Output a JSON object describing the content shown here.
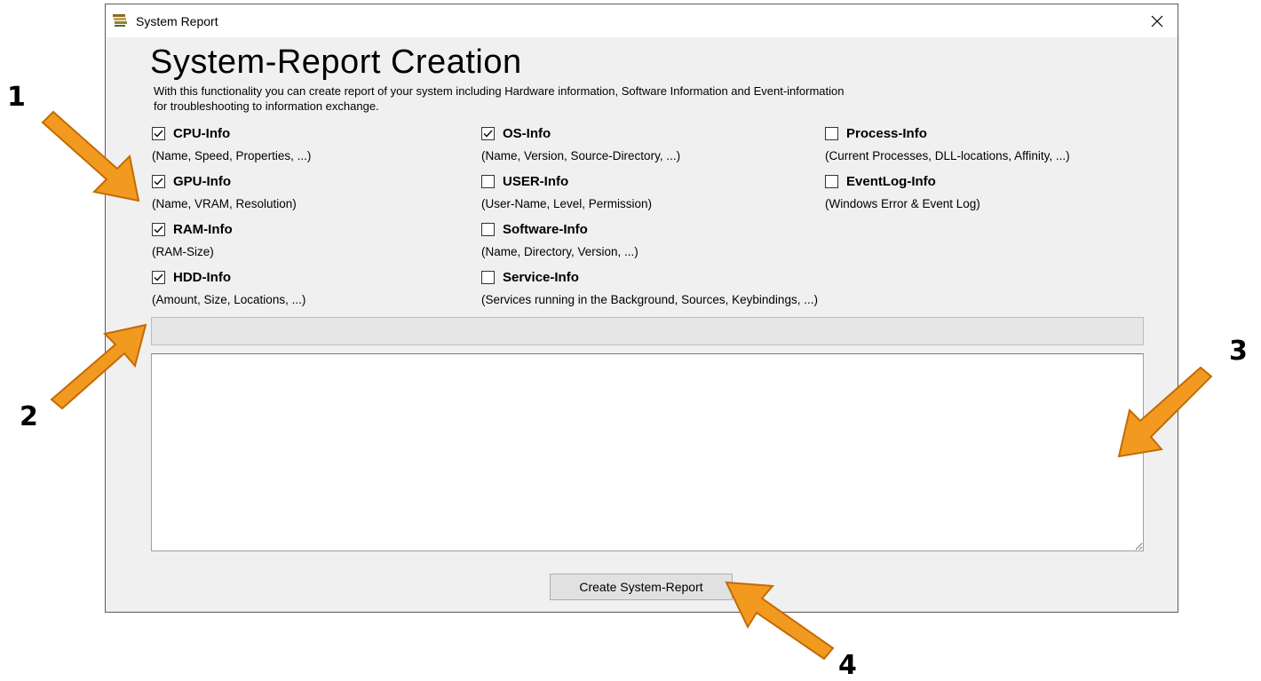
{
  "window": {
    "title": "System Report",
    "close_glyph": "✕",
    "icon": "report-stack-icon"
  },
  "heading": "System-Report Creation",
  "description_line1": "With this functionality you can create report of your system including Hardware information, Software Information and Event-information",
  "description_line2": "for troubleshooting to information exchange.",
  "options": [
    {
      "label": "CPU-Info",
      "sub": "(Name, Speed, Properties, ...)",
      "checked": true
    },
    {
      "label": "OS-Info",
      "sub": "(Name, Version, Source-Directory, ...)",
      "checked": true
    },
    {
      "label": "Process-Info",
      "sub": "(Current Processes, DLL-locations, Affinity, ...)",
      "checked": false
    },
    {
      "label": "GPU-Info",
      "sub": "(Name, VRAM, Resolution)",
      "checked": true
    },
    {
      "label": "USER-Info",
      "sub": "(User-Name, Level, Permission)",
      "checked": false
    },
    {
      "label": "EventLog-Info",
      "sub": "(Windows Error & Event Log)",
      "checked": false
    },
    {
      "label": "RAM-Info",
      "sub": "(RAM-Size)",
      "checked": true
    },
    {
      "label": "Software-Info",
      "sub": "(Name, Directory, Version, ...)",
      "checked": false
    },
    {
      "label": "HDD-Info",
      "sub": "(Amount, Size, Locations, ...)",
      "checked": true
    },
    {
      "label": "Service-Info",
      "sub": "(Services running in the Background, Sources, Keybindings, ...)",
      "checked": false
    }
  ],
  "progress": {
    "value": 0
  },
  "output_text": "",
  "create_button_label": "Create System-Report",
  "callouts": [
    "1",
    "2",
    "3",
    "4"
  ],
  "colors": {
    "arrow_fill": "#f29a1f",
    "arrow_stroke": "#c46a05",
    "window_bg": "#f0f0f0"
  }
}
